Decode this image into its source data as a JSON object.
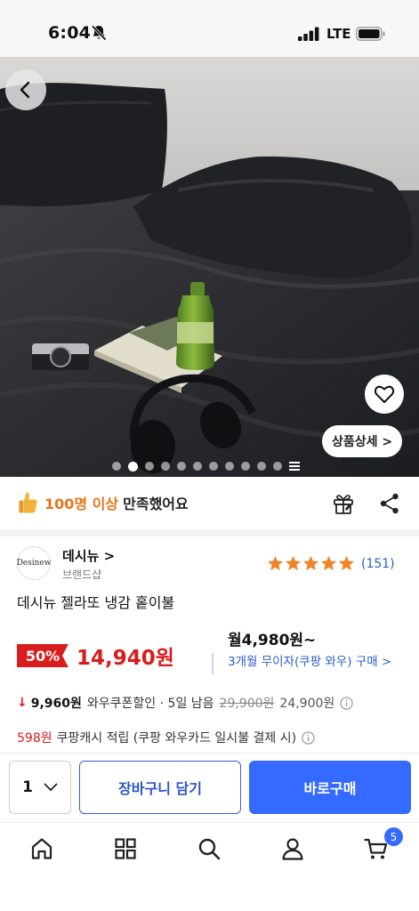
{
  "status_bar": {
    "time": "6:04",
    "network": "LTE"
  },
  "hero": {
    "detail_button_label": "상품상세 >"
  },
  "satisfaction": {
    "count_text": "100명 이상",
    "rest_text": "만족했어요"
  },
  "seller": {
    "logo_text": "Desinew",
    "name": "데시뉴 >",
    "subtitle": "브랜드샵"
  },
  "rating": {
    "stars": 5,
    "review_count": "(151)"
  },
  "product": {
    "title": "데시뉴 젤라또 냉감 홑이불"
  },
  "price": {
    "discount": "50%",
    "sale_price": "14,940원",
    "monthly": "월4,980원~",
    "installment": "3개월 무이자(쿠팡 와우) 구매 >"
  },
  "coupon": {
    "price": "9,960원",
    "label": "와우쿠폰할인 · 5일 남음",
    "original_price": "29,900원",
    "base_price": "24,900원"
  },
  "cash": {
    "amount": "598원",
    "text": "쿠팡캐시 적립 (쿠팡 와우카드 일시불 결제 시)"
  },
  "purchase": {
    "quantity": "1",
    "cart_label": "장바구니 담기",
    "buy_label": "바로구매"
  },
  "tab_bar": {
    "cart_badge": "5"
  },
  "colors": {
    "accent_blue": "#346aff",
    "sale_red": "#d91d1d",
    "badge_orange": "#e8741a"
  }
}
